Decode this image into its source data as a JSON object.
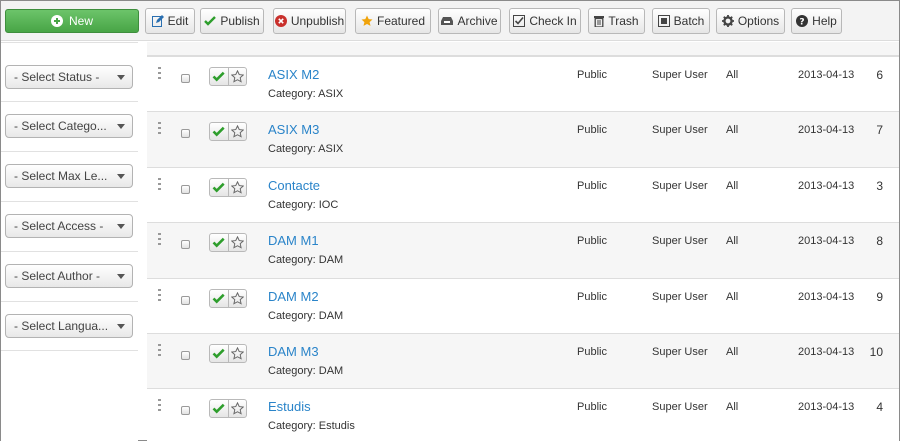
{
  "toolbar": {
    "new": "New",
    "edit": "Edit",
    "publish": "Publish",
    "unpublish": "Unpublish",
    "featured": "Featured",
    "archive": "Archive",
    "checkin": "Check In",
    "trash": "Trash",
    "batch": "Batch",
    "options": "Options",
    "help": "Help"
  },
  "filters": [
    "- Select Status -",
    "- Select Catego...",
    "- Select Max Le...",
    "- Select Access -",
    "- Select Author -",
    "- Select Langua..."
  ],
  "rows": [
    {
      "title": "ASIX M2",
      "category": "Category: ASIX",
      "access": "Public",
      "author": "Super User",
      "language": "All",
      "date": "2013-04-13",
      "id": "6"
    },
    {
      "title": "ASIX M3",
      "category": "Category: ASIX",
      "access": "Public",
      "author": "Super User",
      "language": "All",
      "date": "2013-04-13",
      "id": "7"
    },
    {
      "title": "Contacte",
      "category": "Category: IOC",
      "access": "Public",
      "author": "Super User",
      "language": "All",
      "date": "2013-04-13",
      "id": "3"
    },
    {
      "title": "DAM M1",
      "category": "Category: DAM",
      "access": "Public",
      "author": "Super User",
      "language": "All",
      "date": "2013-04-13",
      "id": "8"
    },
    {
      "title": "DAM M2",
      "category": "Category: DAM",
      "access": "Public",
      "author": "Super User",
      "language": "All",
      "date": "2013-04-13",
      "id": "9"
    },
    {
      "title": "DAM M3",
      "category": "Category: DAM",
      "access": "Public",
      "author": "Super User",
      "language": "All",
      "date": "2013-04-13",
      "id": "10"
    },
    {
      "title": "Estudis",
      "category": "Category: Estudis",
      "access": "Public",
      "author": "Super User",
      "language": "All",
      "date": "2013-04-13",
      "id": "4"
    }
  ],
  "colors": {
    "accent_green": "#51b04f",
    "link_blue": "#2a84c9",
    "check_green": "#2e9e2c",
    "danger_red": "#c9302c",
    "star_orange": "#f0a30a"
  }
}
